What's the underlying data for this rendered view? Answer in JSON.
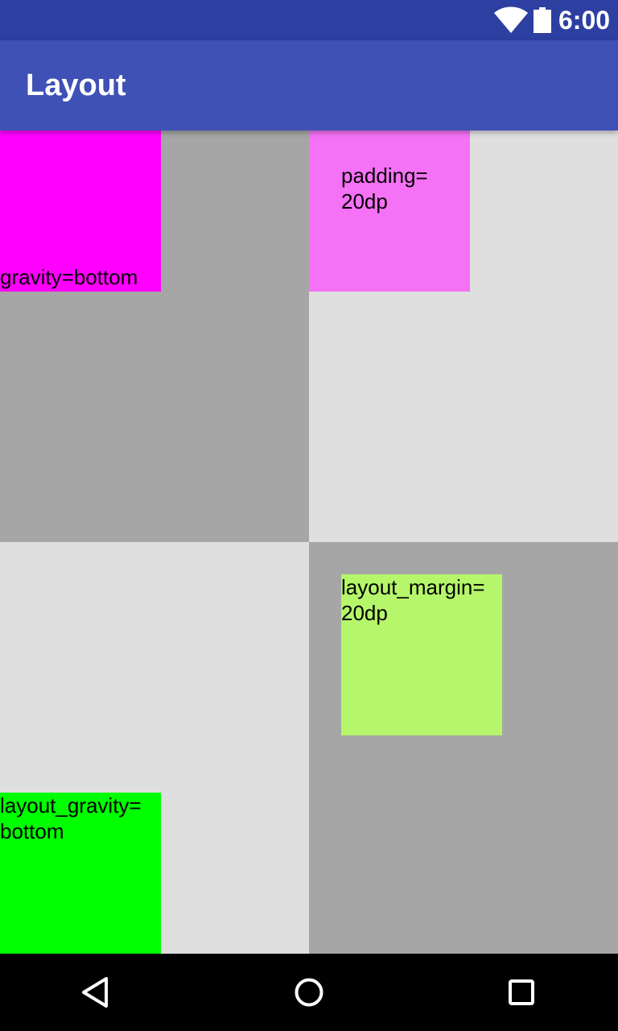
{
  "status_bar": {
    "time": "6:00",
    "icons": [
      "wifi-icon",
      "battery-icon"
    ]
  },
  "app_bar": {
    "title": "Layout"
  },
  "cells": [
    {
      "color": "#a6a6a6",
      "box": {
        "label": "gravity=bottom",
        "color": "#ff00ff"
      }
    },
    {
      "color": "#e0dfe0",
      "box": {
        "label": "padding= 20dp",
        "color": "#f571f5"
      }
    },
    {
      "color": "#e0dfe0",
      "box": {
        "label": "layout_gravity= bottom",
        "color": "#00ff00"
      }
    },
    {
      "color": "#a6a6a6",
      "box": {
        "label": "layout_margin= 20dp",
        "color": "#b5f66a"
      }
    }
  ],
  "nav_bar": {
    "buttons": [
      "back-icon",
      "home-icon",
      "recents-icon"
    ]
  },
  "colors": {
    "status_bar": "#2d3fa0",
    "app_bar": "#3f51b5",
    "nav_bar": "#000000"
  }
}
